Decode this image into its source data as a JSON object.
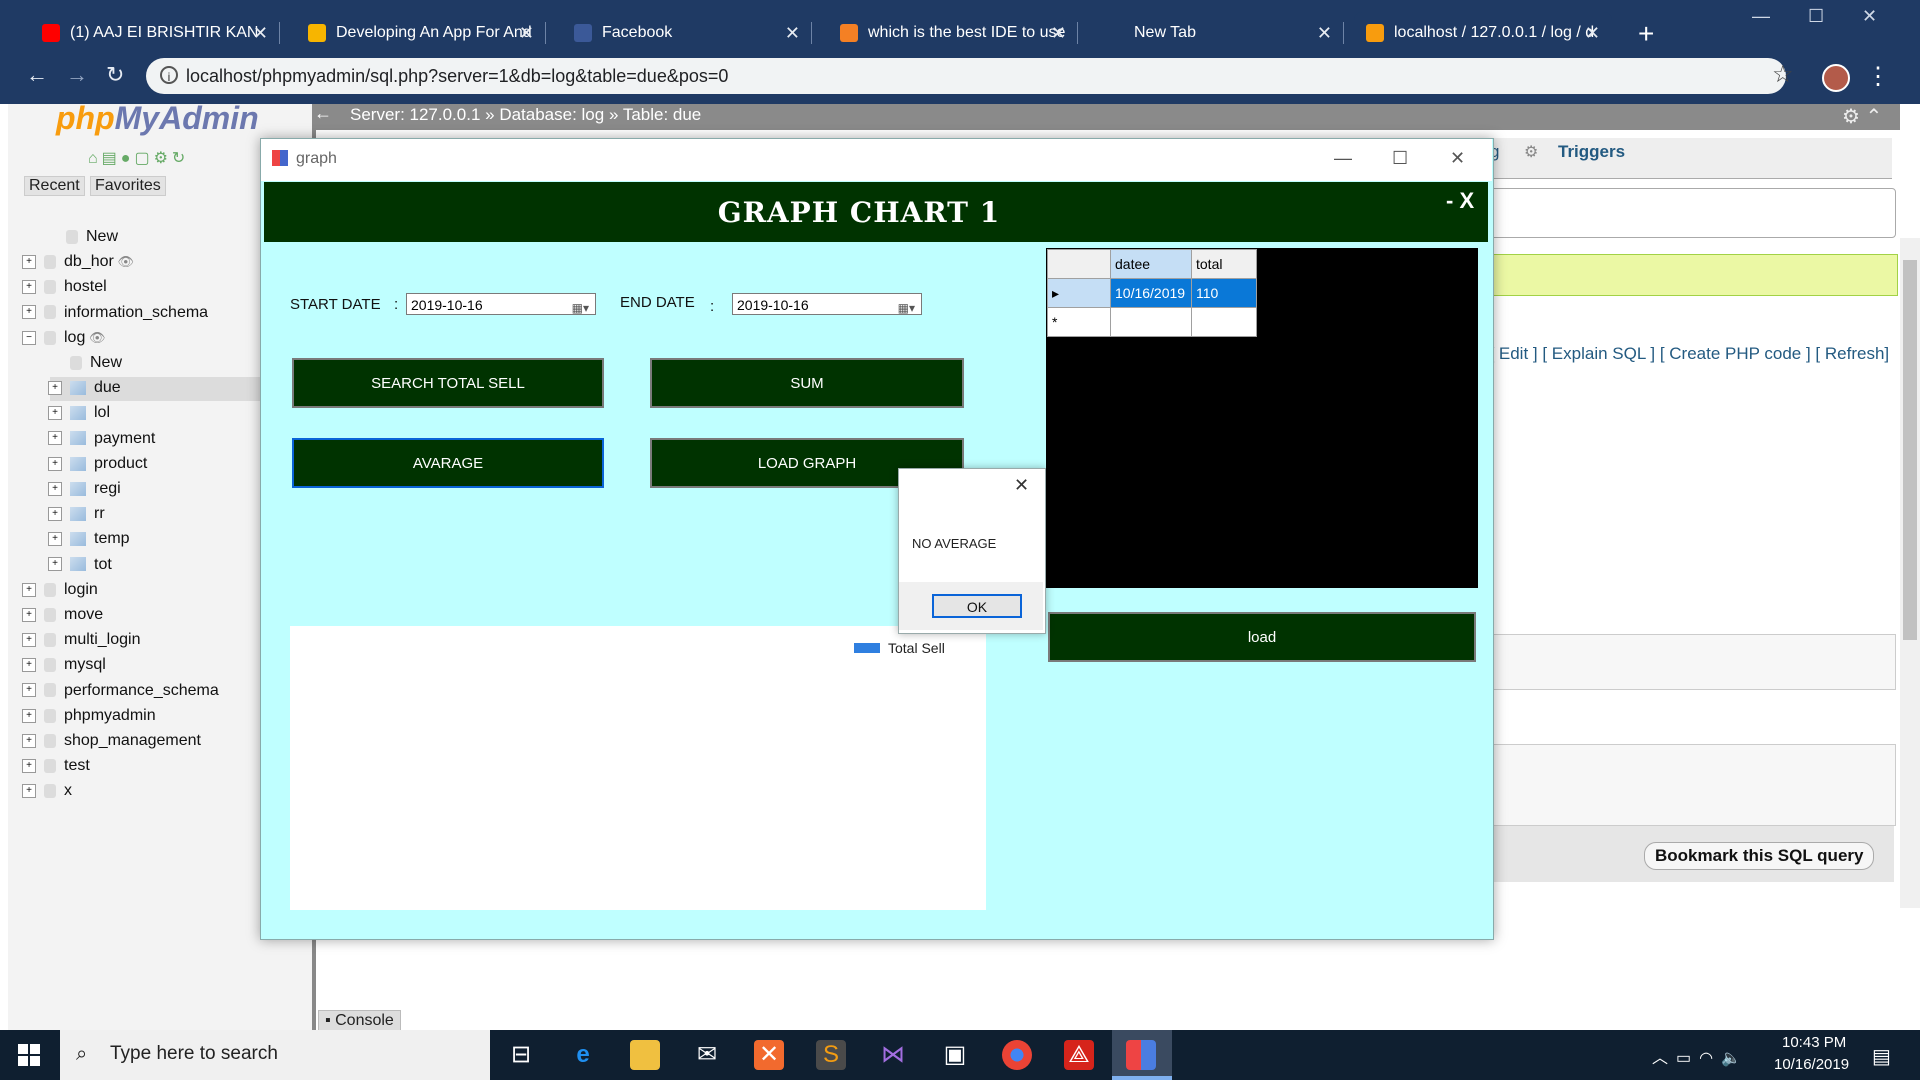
{
  "browser": {
    "tabs": [
      {
        "title": "(1) AAJ EI BRISHTIR KAN",
        "favicon_color": "#ff0000",
        "muted_icon": "speaker-icon"
      },
      {
        "title": "Developing An App For And",
        "favicon_color": "#f7b500"
      },
      {
        "title": "Facebook",
        "favicon_color": "#3b5998"
      },
      {
        "title": "which is the best IDE to use",
        "favicon_color": "#f48024"
      },
      {
        "title": "New Tab",
        "favicon_color": ""
      },
      {
        "title": "localhost / 127.0.0.1 / log / d",
        "favicon_color": "#f89c0e",
        "active": true
      }
    ],
    "url": "localhost/phpmyadmin/sql.php?server=1&db=log&table=due&pos=0"
  },
  "pma": {
    "logo_php": "php",
    "logo_rest": "MyAdmin",
    "tab_recent": "Recent",
    "tab_favorites": "Favorites",
    "tree": [
      {
        "label": "New",
        "level": 1,
        "kind": "new"
      },
      {
        "label": "db_hor",
        "level": 0,
        "kind": "db",
        "eye": true
      },
      {
        "label": "hostel",
        "level": 0,
        "kind": "db"
      },
      {
        "label": "information_schema",
        "level": 0,
        "kind": "db"
      },
      {
        "label": "log",
        "level": 0,
        "kind": "db",
        "eye": true,
        "expanded": true
      },
      {
        "label": "New",
        "level": 2,
        "kind": "new"
      },
      {
        "label": "due",
        "level": 2,
        "kind": "table",
        "selected": true
      },
      {
        "label": "lol",
        "level": 2,
        "kind": "table"
      },
      {
        "label": "payment",
        "level": 2,
        "kind": "table"
      },
      {
        "label": "product",
        "level": 2,
        "kind": "table"
      },
      {
        "label": "regi",
        "level": 2,
        "kind": "table"
      },
      {
        "label": "rr",
        "level": 2,
        "kind": "table"
      },
      {
        "label": "temp",
        "level": 2,
        "kind": "table"
      },
      {
        "label": "tot",
        "level": 2,
        "kind": "table"
      },
      {
        "label": "login",
        "level": 0,
        "kind": "db"
      },
      {
        "label": "move",
        "level": 0,
        "kind": "db"
      },
      {
        "label": "multi_login",
        "level": 0,
        "kind": "db"
      },
      {
        "label": "mysql",
        "level": 0,
        "kind": "db"
      },
      {
        "label": "performance_schema",
        "level": 0,
        "kind": "db"
      },
      {
        "label": "phpmyadmin",
        "level": 0,
        "kind": "db"
      },
      {
        "label": "shop_management",
        "level": 0,
        "kind": "db"
      },
      {
        "label": "test",
        "level": 0,
        "kind": "db"
      },
      {
        "label": "x",
        "level": 0,
        "kind": "db"
      }
    ],
    "breadcrumb": "Server: 127.0.0.1 » Database: log » Table: due",
    "tab_partial": "g",
    "tab_triggers": "Triggers",
    "query_links": "] [ Edit ] [ Explain SQL ] [ Create PHP code ] [ Refresh]",
    "bookmark_button": "Bookmark this SQL query",
    "console_label": "Console"
  },
  "graph_window": {
    "title": "graph",
    "heading": "GRAPH CHART 1",
    "header_controls": "- X",
    "start_label": "START DATE",
    "end_label": "END DATE",
    "colon": ":",
    "start_date": "2019-10-16",
    "end_date": "2019-10-16",
    "buttons": {
      "search_total": "SEARCH TOTAL SELL",
      "sum": "SUM",
      "average": "AVARAGE",
      "load_graph": "LOAD GRAPH",
      "load": "load"
    },
    "legend": "Total Sell",
    "grid": {
      "columns": [
        "datee",
        "total"
      ],
      "rows": [
        [
          "10/16/2019",
          "110"
        ]
      ],
      "new_row_marker": "*",
      "current_row_marker": "▸"
    }
  },
  "message_box": {
    "text": "NO AVERAGE",
    "ok": "OK"
  },
  "taskbar": {
    "search_placeholder": "Type here to search",
    "time": "10:43 PM",
    "date": "10/16/2019"
  }
}
